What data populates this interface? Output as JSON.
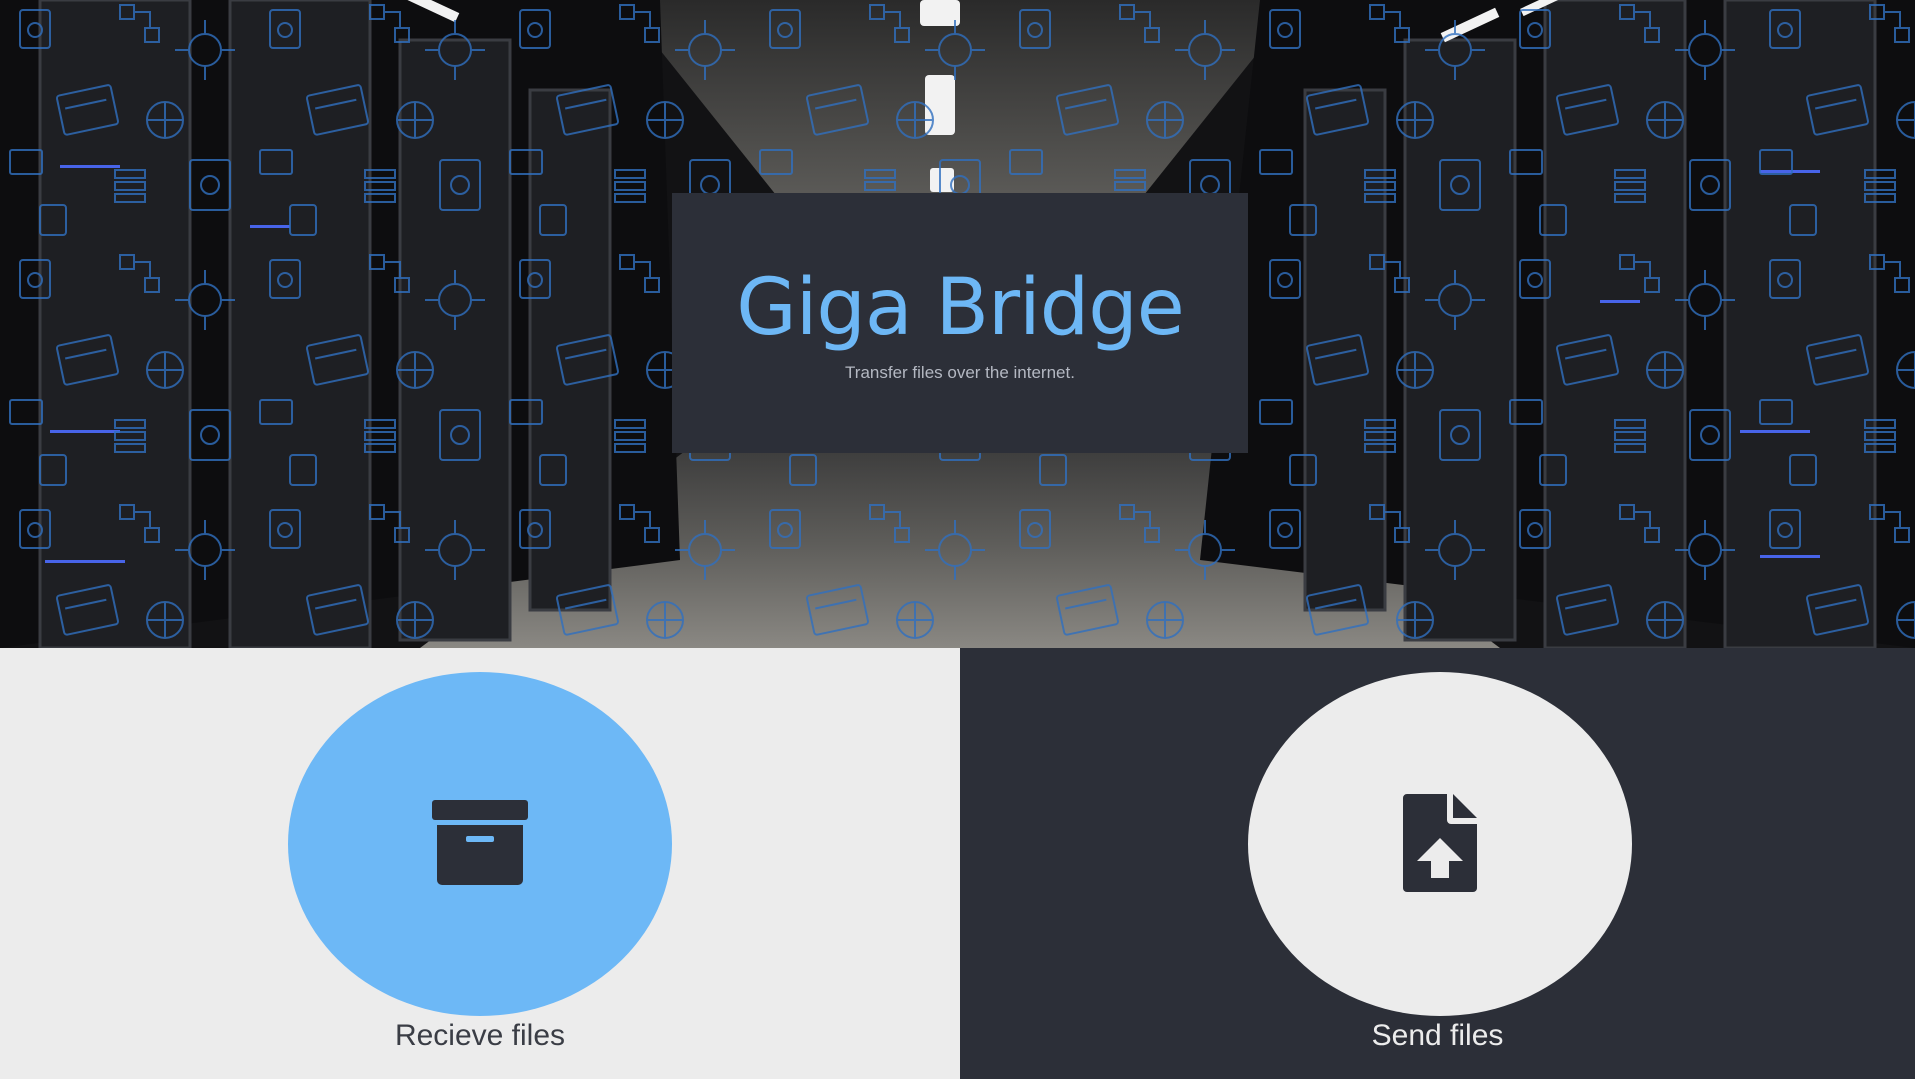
{
  "hero": {
    "title": "Giga Bridge",
    "subtitle": "Transfer files over the internet.",
    "background": "server-room-photo"
  },
  "actions": {
    "receive": {
      "label": "Recieve files",
      "icon": "archive-box-icon",
      "circle_color": "#6db8f6"
    },
    "send": {
      "label": "Send files",
      "icon": "file-upload-icon",
      "circle_color": "#ececec"
    }
  },
  "colors": {
    "accent": "#6db7f5",
    "dark": "#2c2f38",
    "light": "#ececec"
  }
}
